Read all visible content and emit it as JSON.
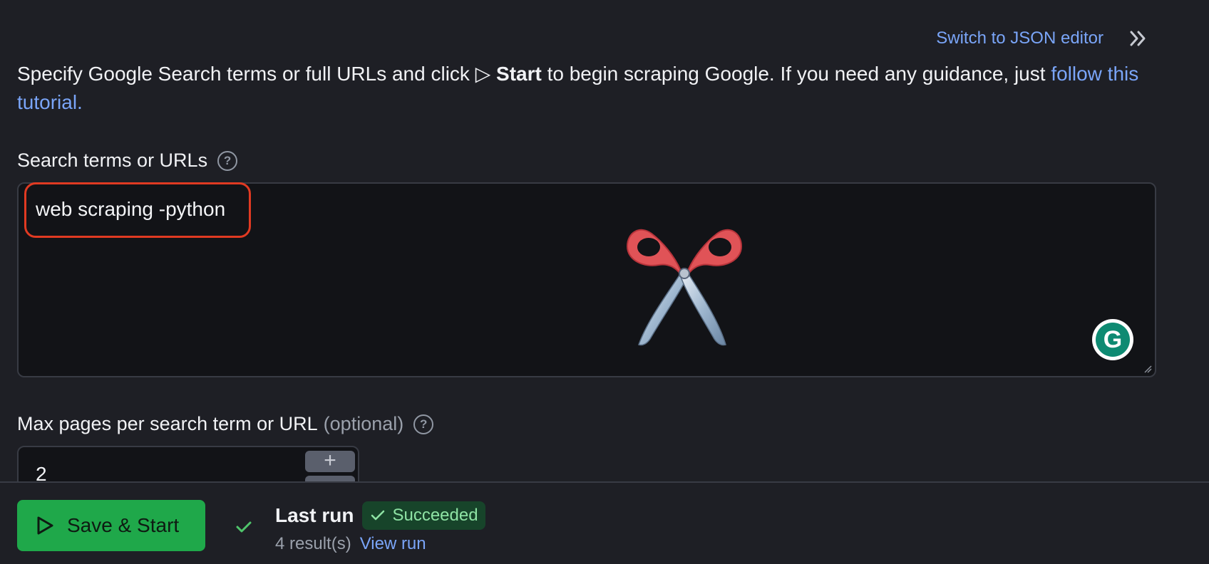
{
  "header": {
    "switch_editor_label": "Switch to JSON editor"
  },
  "intro": {
    "text_before": "Specify Google Search terms or full URLs and click ",
    "start_symbol": "▷",
    "start_word": "Start",
    "text_middle": " to begin scraping Google. If you need any guidance, just ",
    "tutorial_link": "follow this tutorial."
  },
  "search_terms": {
    "label": "Search terms or URLs",
    "help": "?",
    "value": "web scraping -python"
  },
  "max_pages": {
    "label": "Max pages per search term or URL",
    "optional": "(optional)",
    "help": "?",
    "value": "2",
    "increment": "+"
  },
  "footer": {
    "save_start_label": "Save & Start",
    "last_run_label": "Last run",
    "status_label": "Succeeded",
    "results_label": "4 result(s)",
    "view_run_label": "View run"
  },
  "colors": {
    "accent_green": "#1fa84a",
    "link_blue": "#7aa5f8",
    "highlight_red": "#e03a22",
    "background": "#1e1f25"
  },
  "icons": [
    "expand-icon",
    "help-icon",
    "scissors-icon",
    "grammarly-icon",
    "play-icon",
    "check-icon"
  ]
}
